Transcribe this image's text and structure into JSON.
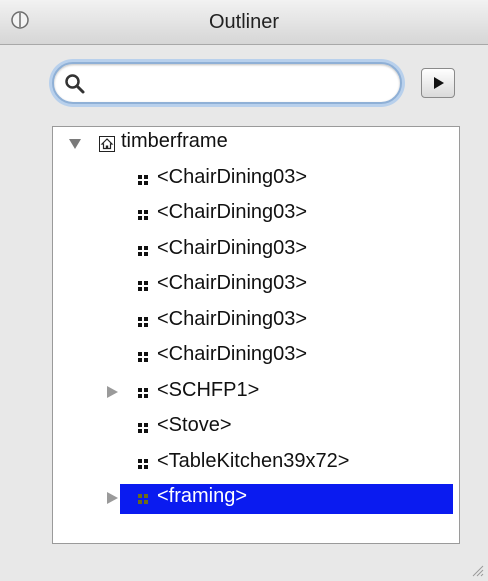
{
  "window": {
    "title": "Outliner"
  },
  "search": {
    "value": "",
    "placeholder": ""
  },
  "tree": {
    "root": {
      "label": "timberframe",
      "expanded": true
    },
    "items": [
      {
        "label": "<ChairDining03>",
        "has_children": false,
        "selected": false
      },
      {
        "label": "<ChairDining03>",
        "has_children": false,
        "selected": false
      },
      {
        "label": "<ChairDining03>",
        "has_children": false,
        "selected": false
      },
      {
        "label": "<ChairDining03>",
        "has_children": false,
        "selected": false
      },
      {
        "label": "<ChairDining03>",
        "has_children": false,
        "selected": false
      },
      {
        "label": "<ChairDining03>",
        "has_children": false,
        "selected": false
      },
      {
        "label": "<SCHFP1>",
        "has_children": true,
        "selected": false
      },
      {
        "label": "<Stove>",
        "has_children": false,
        "selected": false
      },
      {
        "label": "<TableKitchen39x72>",
        "has_children": false,
        "selected": false
      },
      {
        "label": "<framing>",
        "has_children": true,
        "selected": true
      }
    ]
  },
  "colors": {
    "selection": "#0a1bf0",
    "focus_ring": "#8fb0d6"
  }
}
